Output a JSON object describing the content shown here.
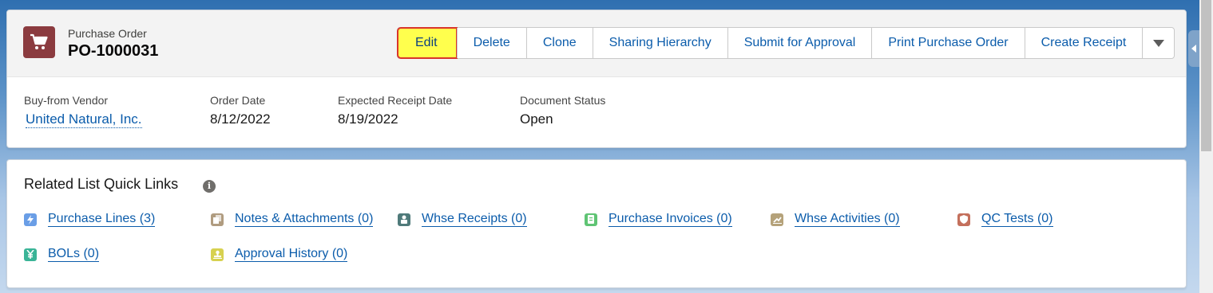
{
  "record": {
    "object_type": "Purchase Order",
    "title": "PO-1000031",
    "icon": "cart-icon",
    "icon_color": "#8b3b3f"
  },
  "actions": {
    "buttons": [
      {
        "label": "Edit",
        "highlighted": true
      },
      {
        "label": "Delete"
      },
      {
        "label": "Clone"
      },
      {
        "label": "Sharing Hierarchy"
      },
      {
        "label": "Submit for Approval"
      },
      {
        "label": "Print Purchase Order"
      },
      {
        "label": "Create Receipt"
      }
    ],
    "more_icon": "chevron-down-icon"
  },
  "highlights": [
    {
      "label": "Buy-from Vendor",
      "value": "United Natural, Inc."
    },
    {
      "label": "Order Date",
      "value": "8/12/2022"
    },
    {
      "label": "Expected Receipt Date",
      "value": "8/19/2022"
    },
    {
      "label": "Document Status",
      "value": "Open"
    }
  ],
  "related": {
    "title": "Related List Quick Links",
    "info_icon": "info-icon",
    "links": [
      {
        "label": "Purchase Lines (3)",
        "icon": "bolt-icon",
        "color": "#6a9ee6"
      },
      {
        "label": "Notes & Attachments (0)",
        "icon": "notes-icon",
        "color": "#b09c80"
      },
      {
        "label": "Whse Receipts (0)",
        "icon": "receipt-icon",
        "color": "#4f7a7a"
      },
      {
        "label": "Purchase Invoices (0)",
        "icon": "invoice-icon",
        "color": "#5fc474"
      },
      {
        "label": "Whse Activities (0)",
        "icon": "activity-icon",
        "color": "#b5a27a"
      },
      {
        "label": "QC Tests (0)",
        "icon": "shield-icon",
        "color": "#c4705c"
      },
      {
        "label": "BOLs (0)",
        "icon": "yen-icon",
        "color": "#3ab497"
      },
      {
        "label": "Approval History (0)",
        "icon": "stamp-icon",
        "color": "#d7d150"
      }
    ]
  }
}
